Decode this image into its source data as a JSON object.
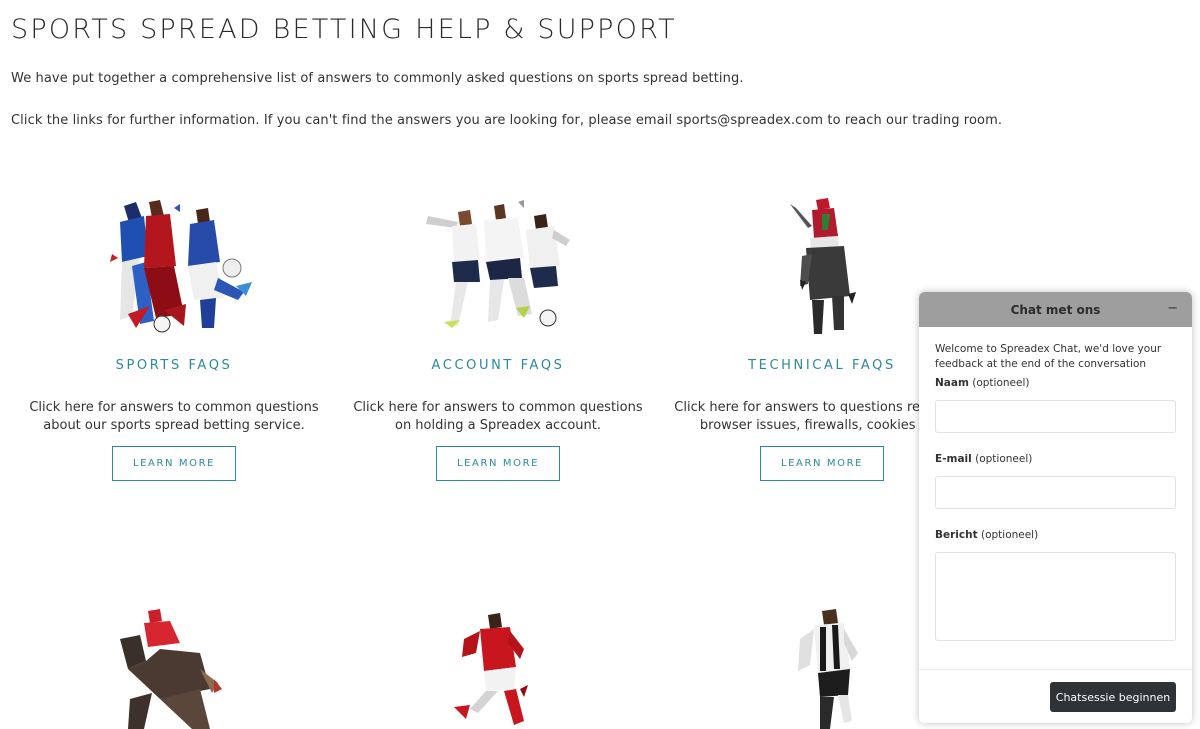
{
  "page": {
    "title": "SPORTS SPREAD BETTING HELP & SUPPORT",
    "intro_1": "We have put together a comprehensive list of answers to commonly asked questions on sports spread betting.",
    "intro_2_before": "Click the links for further information. If you can't find the answers you are looking for, please email ",
    "intro_2_email": "sports@spreadex.com",
    "intro_2_after": " to reach our trading room."
  },
  "cards": [
    {
      "title": "SPORTS FAQS",
      "desc_1": "Click here for answers to common questions",
      "desc_2": "about our sports spread betting service.",
      "button": "LEARN MORE"
    },
    {
      "title": "ACCOUNT FAQS",
      "desc_1": "Click here for answers to common questions",
      "desc_2": "on holding a Spreadex account.",
      "button": "LEARN MORE"
    },
    {
      "title": "TECHNICAL FAQS",
      "desc_1": "Click here for answers to questions regarding",
      "desc_2": "browser issues, firewalls, cookies etc.",
      "button": "LEARN MORE"
    }
  ],
  "chat": {
    "title": "Chat met ons",
    "minimize": "−",
    "welcome": "Welcome to Spreadex Chat, we'd love your feedback at the end of the conversation",
    "name_label": "Naam",
    "email_label": "E-mail",
    "message_label": "Bericht",
    "optional": "(optioneel)",
    "start_button": "Chatsessie beginnen"
  },
  "colors": {
    "accent": "#2b8a99",
    "chat_header": "#9e9e9e",
    "chat_button": "#2e3338"
  }
}
